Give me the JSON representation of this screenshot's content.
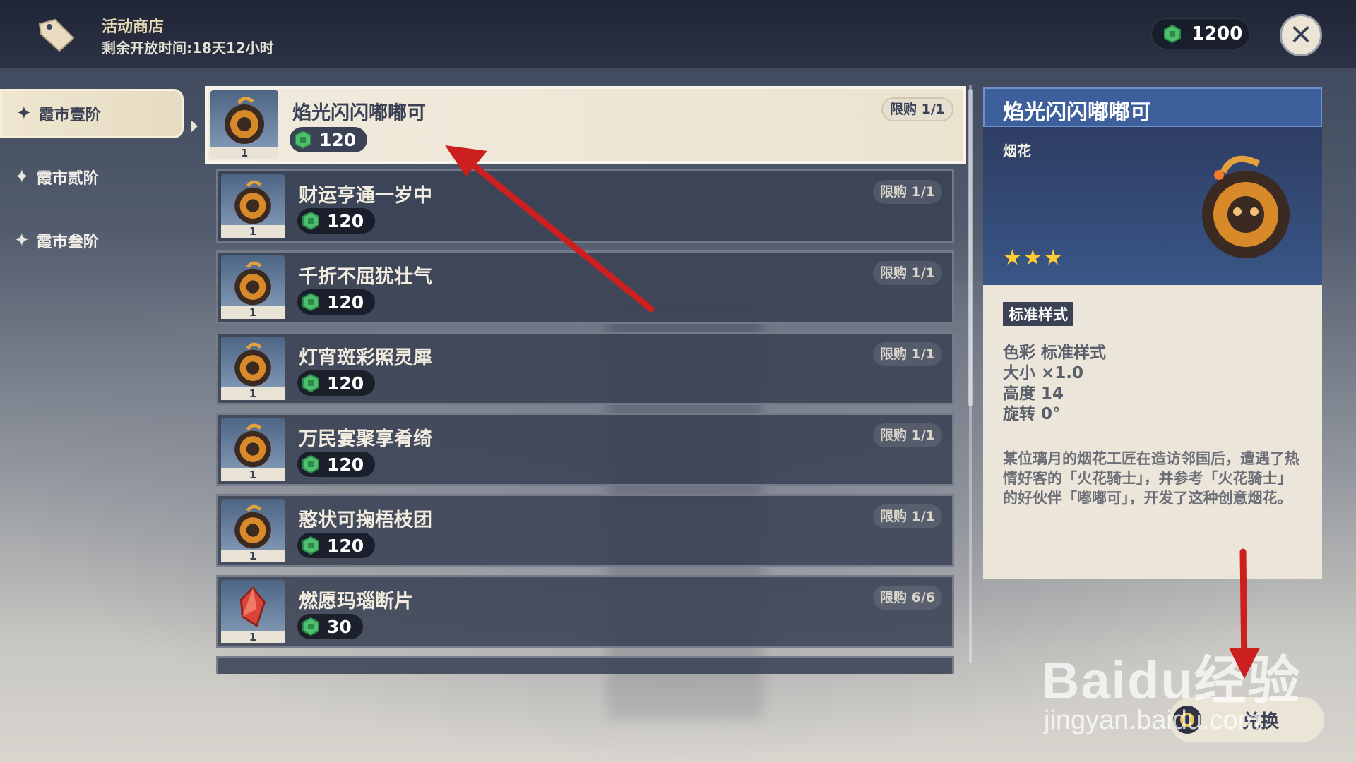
{
  "header": {
    "shop_title": "活动商店",
    "timer": "剩余开放时间:18天12小时",
    "currency_value": "1200",
    "icons": [
      "tag-icon",
      "coin-icon",
      "close-icon"
    ]
  },
  "sidebar": {
    "items": [
      {
        "label": "霞市壹阶",
        "active": true
      },
      {
        "label": "霞市贰阶",
        "active": false
      },
      {
        "label": "霞市叁阶",
        "active": false
      }
    ]
  },
  "items": [
    {
      "name": "焰光闪闪嘟嘟可",
      "price": "120",
      "limit": "限购 1/1",
      "qty": "1",
      "selected": true
    },
    {
      "name": "财运亨通一岁中",
      "price": "120",
      "limit": "限购 1/1",
      "qty": "1"
    },
    {
      "name": "千折不屈犹壮气",
      "price": "120",
      "limit": "限购 1/1",
      "qty": "1"
    },
    {
      "name": "灯宵斑彩照灵犀",
      "price": "120",
      "limit": "限购 1/1",
      "qty": "1"
    },
    {
      "name": "万民宴聚享肴绮",
      "price": "120",
      "limit": "限购 1/1",
      "qty": "1"
    },
    {
      "name": "憨状可掬梧枝团",
      "price": "120",
      "limit": "限购 1/1",
      "qty": "1"
    },
    {
      "name": "燃愿玛瑙断片",
      "price": "30",
      "limit": "限购 6/6",
      "qty": "1"
    }
  ],
  "detail": {
    "title": "焰光闪闪嘟嘟可",
    "category": "烟花",
    "stars": "★★★",
    "rarity": 3,
    "style_badge": "标准样式",
    "attrs": [
      "色彩 标准样式",
      "大小 ×1.0",
      "高度 14",
      "旋转 0°"
    ],
    "description": "某位璃月的烟花工匠在造访邻国后，遭遇了热情好客的「火花骑士」，并参考「火花骑士」的好伙伴「嘟嘟可」，开发了这种创意烟花。"
  },
  "actions": {
    "exchange_label": "兑换"
  },
  "watermark": {
    "main": "Baidu经验",
    "url": "jingyan.baidu.com"
  },
  "colors": {
    "accent_blue": "#3d5f9c",
    "cream": "#ece6da",
    "dark_panel": "#3b4256",
    "star_gold": "#ffcc33",
    "annotation_red": "#cc1f1f"
  }
}
